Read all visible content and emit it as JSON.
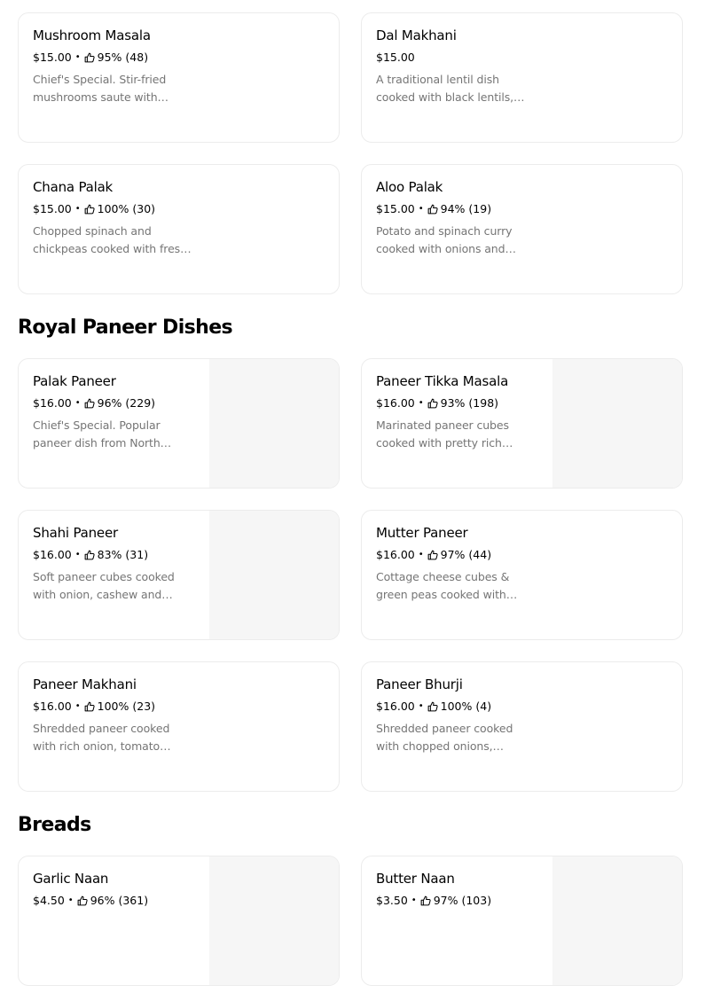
{
  "sections": [
    {
      "title": ""
    },
    {
      "title": "Royal Paneer Dishes"
    },
    {
      "title": "Breads"
    }
  ],
  "items": [
    {
      "name": "Mushroom Masala",
      "price": "$15.00",
      "rating": "95% (48)",
      "description": "Chief's Special. Stir-fried mushrooms saute with…"
    },
    {
      "name": "Dal Makhani",
      "price": "$15.00",
      "rating": "",
      "description": "A traditional lentil dish cooked with black lentils,…"
    },
    {
      "name": "Chana Palak",
      "price": "$15.00",
      "rating": "100% (30)",
      "description": "Chopped spinach and chickpeas cooked with fres…"
    },
    {
      "name": "Aloo Palak",
      "price": "$15.00",
      "rating": "94% (19)",
      "description": "Potato and spinach curry cooked with onions and…"
    },
    {
      "name": "Palak Paneer",
      "price": "$16.00",
      "rating": "96% (229)",
      "description": "Chief's Special. Popular paneer dish from North…"
    },
    {
      "name": "Paneer Tikka Masala",
      "price": "$16.00",
      "rating": "93% (198)",
      "description": "Marinated paneer cubes cooked with pretty rich…"
    },
    {
      "name": "Shahi Paneer",
      "price": "$16.00",
      "rating": "83% (31)",
      "description": "Soft paneer cubes cooked with onion, cashew and…"
    },
    {
      "name": "Mutter Paneer",
      "price": "$16.00",
      "rating": "97% (44)",
      "description": "Cottage cheese cubes & green peas cooked with…"
    },
    {
      "name": "Paneer Makhani",
      "price": "$16.00",
      "rating": "100% (23)",
      "description": "Shredded paneer cooked with rich onion, tomato…"
    },
    {
      "name": "Paneer Bhurji",
      "price": "$16.00",
      "rating": "100% (4)",
      "description": "Shredded paneer cooked with chopped onions,…"
    },
    {
      "name": "Garlic Naan",
      "price": "$4.50",
      "rating": "96% (361)",
      "description": ""
    },
    {
      "name": "Butter Naan",
      "price": "$3.50",
      "rating": "97% (103)",
      "description": ""
    }
  ],
  "separator": "•",
  "icons": {
    "rating": "thumbs-up-icon"
  },
  "colors": {
    "text": "#000000",
    "muted": "#757575",
    "border": "#ececec",
    "photo_placeholder": "#f6f6f6"
  }
}
